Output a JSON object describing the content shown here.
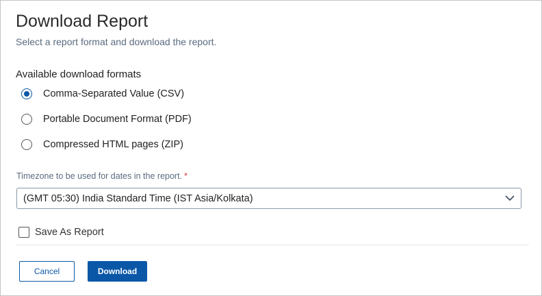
{
  "dialog": {
    "title": "Download Report",
    "subtitle": "Select a report format and download the report."
  },
  "formats": {
    "label": "Available download formats",
    "options": [
      {
        "label": "Comma-Separated Value (CSV)",
        "selected": true
      },
      {
        "label": "Portable Document Format (PDF)",
        "selected": false
      },
      {
        "label": "Compressed HTML pages (ZIP)",
        "selected": false
      }
    ]
  },
  "timezone": {
    "label": "Timezone to be used for dates in the report.",
    "required_marker": "*",
    "value": "(GMT 05:30) India Standard Time (IST Asia/Kolkata)"
  },
  "save_as_report": {
    "label": "Save As Report",
    "checked": false
  },
  "buttons": {
    "cancel": "Cancel",
    "download": "Download"
  },
  "colors": {
    "accent": "#0a57a8",
    "required": "#d23b3b",
    "muted_text": "#5a6b80"
  },
  "icons": {
    "select_arrow": "chevron-down-icon"
  }
}
